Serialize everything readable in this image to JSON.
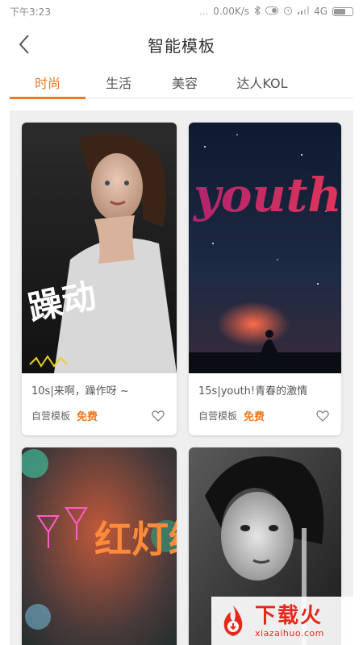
{
  "status_bar": {
    "time": "下午3:23",
    "network_speed": "0.00K/s",
    "signal_label": "4G"
  },
  "header": {
    "title": "智能模板",
    "back_icon": "chevron-left-icon"
  },
  "tabs": [
    {
      "label": "时尚",
      "active": true
    },
    {
      "label": "生活",
      "active": false
    },
    {
      "label": "美容",
      "active": false
    },
    {
      "label": "达人KOL",
      "active": false
    }
  ],
  "cards": [
    {
      "title": "10s|来啊，躁作呀 ~",
      "source_label": "自营模板",
      "price_label": "免费",
      "image_overlay_text": "躁动",
      "icon": "heart-icon"
    },
    {
      "title": "15s|youth!青春的激情",
      "source_label": "自营模板",
      "price_label": "免费",
      "image_overlay_text": "youth",
      "icon": "heart-icon"
    },
    {
      "title": "",
      "image_overlay_text": "红灯绿"
    },
    {
      "title": ""
    }
  ],
  "watermark": {
    "title": "下载火",
    "url": "xiazaihuo.com"
  },
  "colors": {
    "accent": "#f07a22",
    "watermark_red": "#e4291c",
    "background": "#efefef"
  }
}
